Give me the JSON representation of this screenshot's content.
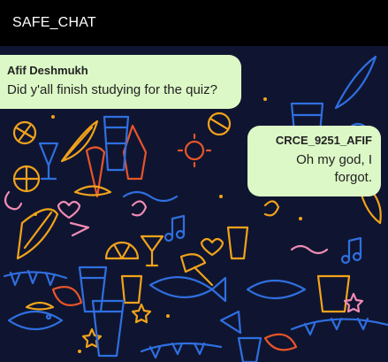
{
  "header": {
    "title": "SAFE_CHAT"
  },
  "messages": [
    {
      "direction": "received",
      "sender": "Afif Deshmukh",
      "text": "Did y'all finish studying for the quiz?"
    },
    {
      "direction": "sent",
      "sender": "CRCE_9251_AFIF",
      "text": "Oh my god, I forgot."
    }
  ],
  "theme": {
    "header_bg": "#000000",
    "bubble_bg": "#dcf8c6",
    "wallpaper_bg": "#0f1530",
    "doodle_colors": [
      "#f2a31b",
      "#2f6fe0",
      "#f08bb5",
      "#e8552a"
    ]
  }
}
